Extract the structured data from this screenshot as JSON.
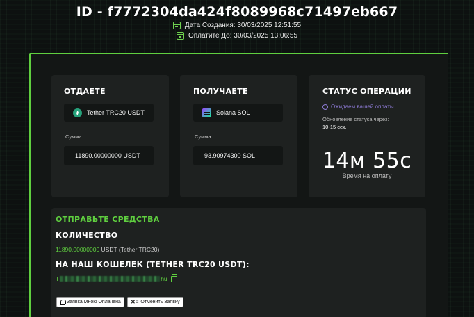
{
  "header": {
    "order_id": "ID - f7772304da424f8089968c71497eb667",
    "created_label": "Дата Создания: 30/03/2025 12:51:55",
    "pay_until_label": "Оплатите До: 30/03/2025 13:06:55"
  },
  "give": {
    "title": "ОТДАЕТЕ",
    "currency": "Tether TRC20 USDT",
    "amount_label": "Сумма",
    "amount": "11890.00000000 USDT"
  },
  "receive": {
    "title": "ПОЛУЧАЕТЕ",
    "currency": "Solana SOL",
    "amount_label": "Сумма",
    "amount": "93.90974300 SOL"
  },
  "status": {
    "title": "СТАТУС ОПЕРАЦИИ",
    "state": "Ожидаем вашей оплаты",
    "refresh_label": "Обновление статуса через:",
    "refresh_value": "10-15 сек.",
    "timer": "14м 55с",
    "timer_caption": "Время на оплату"
  },
  "send": {
    "title": "ОТПРАВЬТЕ СРЕДСТВА",
    "quantity_title": "КОЛИЧЕСТВО",
    "quantity_value": "11890.00000000",
    "quantity_unit": " USDT (Tether TRC20)",
    "wallet_title": "НА НАШ КОШЕЛЕК (TETHER TRC20 USDT):",
    "wallet_prefix": "T",
    "wallet_suffix": "hu",
    "btn_paid": "Заявка Мною Оплачена",
    "btn_cancel": "Отменить Заявку"
  },
  "colors": {
    "accent_green": "#5fcf3f",
    "status_purple": "#8e7bd6",
    "tether_green": "#26a17b"
  },
  "icons": [
    "calendar-icon",
    "tether-icon",
    "solana-icon",
    "clock-icon",
    "copy-icon",
    "bell-icon",
    "cancel-list-icon"
  ]
}
